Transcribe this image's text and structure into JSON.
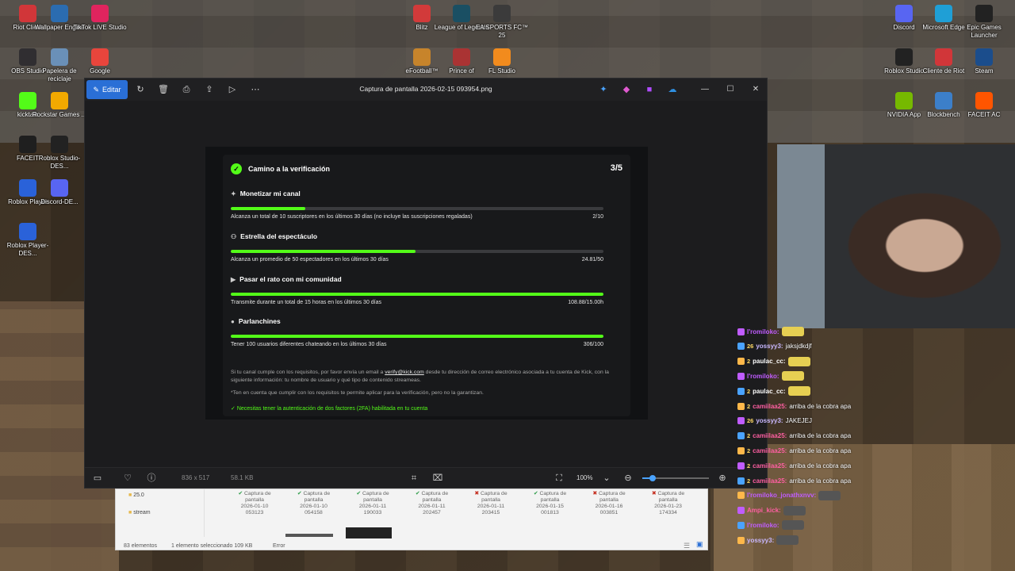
{
  "desktop": {
    "left_icons": [
      {
        "label": "Riot Client",
        "icon": "riot-icon",
        "color": "#d13639"
      },
      {
        "label": "Wallpaper Engine",
        "icon": "wallpaper-engine-icon",
        "color": "#2b6cb0"
      },
      {
        "label": "TikTok LIVE Studio",
        "icon": "tiktok-icon",
        "color": "#e0245e"
      },
      {
        "label": "OBS Studio",
        "icon": "obs-icon",
        "color": "#302e31"
      },
      {
        "label": "Papelera de reciclaje",
        "icon": "recycle-bin-icon",
        "color": "#6a90b8"
      },
      {
        "label": "Google",
        "icon": "chrome-icon",
        "color": "#e8453c"
      },
      {
        "label": "kicktalk",
        "icon": "kicktalk-icon",
        "color": "#53fc18"
      },
      {
        "label": "Rockstar Games ...",
        "icon": "rockstar-icon",
        "color": "#f2a900"
      },
      {
        "label": "FACEIT",
        "icon": "faceit-icon",
        "color": "#1f1f1f"
      },
      {
        "label": "Roblox Studio-DES...",
        "icon": "roblox-studio-icon",
        "color": "#222"
      },
      {
        "label": "Roblox Player",
        "icon": "roblox-player-icon",
        "color": "#2a62d9"
      },
      {
        "label": "Discord-DE...",
        "icon": "discord-icon",
        "color": "#5865f2"
      },
      {
        "label": "Roblox Player-DES...",
        "icon": "roblox-player-icon",
        "color": "#2a62d9"
      }
    ],
    "center_icons": [
      {
        "label": "Blitz",
        "icon": "blitz-icon",
        "color": "#d23a3a"
      },
      {
        "label": "League of Legends",
        "icon": "league-icon",
        "color": "#1a4f63"
      },
      {
        "label": "EA SPORTS FC™ 25",
        "icon": "ea-fc-icon",
        "color": "#3b3b3b"
      },
      {
        "label": "eFootball™",
        "icon": "efootball-icon",
        "color": "#c7842b"
      },
      {
        "label": "Prince of",
        "icon": "prince-icon",
        "color": "#a33"
      },
      {
        "label": "FL Studio",
        "icon": "fl-studio-icon",
        "color": "#f28b1d"
      }
    ],
    "right_icons": [
      {
        "label": "Discord",
        "icon": "discord-icon",
        "color": "#5865f2"
      },
      {
        "label": "Microsoft Edge",
        "icon": "edge-icon",
        "color": "#1f9fd6"
      },
      {
        "label": "Epic Games Launcher",
        "icon": "epic-icon",
        "color": "#222"
      },
      {
        "label": "Roblox Studio",
        "icon": "roblox-studio-icon",
        "color": "#222"
      },
      {
        "label": "Cliente de Riot",
        "icon": "riot-icon",
        "color": "#d13639"
      },
      {
        "label": "Steam",
        "icon": "steam-icon",
        "color": "#1b4d8c"
      },
      {
        "label": "NVIDIA App",
        "icon": "nvidia-icon",
        "color": "#76b900"
      },
      {
        "label": "Blockbench",
        "icon": "blockbench-icon",
        "color": "#3c7fc9"
      },
      {
        "label": "FACEIT AC",
        "icon": "faceit-icon",
        "color": "#ff5500"
      }
    ]
  },
  "viewer": {
    "edit_label": "Editar",
    "title": "Captura de pantalla 2026-02-15 093954.png",
    "dimensions": "836 x 517",
    "filesize": "58.1 KB",
    "zoom": "100%"
  },
  "kick": {
    "header_title": "Camino a la verificación",
    "step_count": "3/5",
    "sections": [
      {
        "title": "Monetizar mi canal",
        "desc": "Alcanza un total de 10 suscriptores en los últimos 30 días (no incluye las suscripciones regaladas)",
        "value": "2/10",
        "progress": 0.2
      },
      {
        "title": "Estrella del espectáculo",
        "desc": "Alcanza un promedio de 50 espectadores en los últimos 30 días",
        "value": "24.81/50",
        "progress": 0.4962
      },
      {
        "title": "Pasar el rato con mi comunidad",
        "desc": "Transmite durante un total de 15 horas en los últimos 30 días",
        "value": "108.88/15.00h",
        "progress": 1.0
      },
      {
        "title": "Parlanchines",
        "desc": "Tener 100 usuarios diferentes chateando en los últimos 30 días",
        "value": "306/100",
        "progress": 1.0
      }
    ],
    "note_pre": "Si tu canal cumple con los requisitos, por favor envía un email a",
    "note_email": "verify@kick.com",
    "note_post": "desde tu dirección de correo electrónico asociada a tu cuenta de Kick, con la siguiente información: tu nombre de usuario y qué tipo de contenido streameas.",
    "note_2": "*Ten en cuenta que cumplir con los requisitos te permite aplicar para la verificación, pero no la garantizan.",
    "twofa": "Necesitas tener la autenticación de dos factores (2FA) habilitada en tu cuenta"
  },
  "explorer": {
    "side_items": [
      "25.0",
      "stream"
    ],
    "files": [
      {
        "l1": "Captura de",
        "l2": "pantalla",
        "l3": "2026-01-10",
        "l4": "053123",
        "status": "ok"
      },
      {
        "l1": "Captura de",
        "l2": "pantalla",
        "l3": "2026-01-10",
        "l4": "054158",
        "status": "ok"
      },
      {
        "l1": "Captura de",
        "l2": "pantalla",
        "l3": "2026-01-11",
        "l4": "190033",
        "status": "ok"
      },
      {
        "l1": "Captura de",
        "l2": "pantalla",
        "l3": "2026-01-11",
        "l4": "202457",
        "status": "ok"
      },
      {
        "l1": "Captura de",
        "l2": "pantalla",
        "l3": "2026-01-11",
        "l4": "203415",
        "status": "err"
      },
      {
        "l1": "Captura de",
        "l2": "pantalla",
        "l3": "2026-01-15",
        "l4": "001813",
        "status": "ok"
      },
      {
        "l1": "Captura de",
        "l2": "pantalla",
        "l3": "2026-01-16",
        "l4": "003851",
        "status": "err"
      },
      {
        "l1": "Captura de",
        "l2": "pantalla",
        "l3": "2026-01-23",
        "l4": "174334",
        "status": "err"
      }
    ],
    "status_count": "83 elementos",
    "status_selected": "1 elemento seleccionado 109 KB",
    "status_error": "Error"
  },
  "chat": [
    {
      "num": "",
      "user": "l'romiloko:",
      "color": "#c05cff",
      "text": "",
      "emote": true
    },
    {
      "num": "26",
      "user": "yossyy3:",
      "color": "#c9b8ff",
      "text": "jaksjdkdjf",
      "emote": false
    },
    {
      "num": "2",
      "user": "paulac_cc:",
      "color": "#ffffff",
      "text": "",
      "emote": true
    },
    {
      "num": "",
      "user": "l'romiloko:",
      "color": "#c05cff",
      "text": "",
      "emote": true
    },
    {
      "num": "2",
      "user": "paulac_cc:",
      "color": "#ffffff",
      "text": "",
      "emote": true
    },
    {
      "num": "2",
      "user": "camiilaa25:",
      "color": "#ff5fa2",
      "text": "arriba de la cobra apa",
      "emote": false
    },
    {
      "num": "26",
      "user": "yossyy3:",
      "color": "#c9b8ff",
      "text": "JAKEJEJ",
      "emote": false
    },
    {
      "num": "2",
      "user": "camiilaa25:",
      "color": "#ff5fa2",
      "text": "arriba de la cobra apa",
      "emote": false
    },
    {
      "num": "2",
      "user": "camiilaa25:",
      "color": "#ff5fa2",
      "text": "arriba de la cobra apa",
      "emote": false
    },
    {
      "num": "2",
      "user": "camiilaa25:",
      "color": "#ff5fa2",
      "text": "arriba de la cobra apa",
      "emote": false
    },
    {
      "num": "2",
      "user": "camiilaa25:",
      "color": "#ff5fa2",
      "text": "arriba de la cobra apa",
      "emote": false
    },
    {
      "num": "",
      "user": "l'romiloko_jonathxnvv:",
      "color": "#c05cff",
      "text": "",
      "emote": true
    },
    {
      "num": "",
      "user": "Ampi_kick:",
      "color": "#ff5fa2",
      "text": "",
      "emote": true
    },
    {
      "num": "",
      "user": "l'romiloko:",
      "color": "#c05cff",
      "text": "",
      "emote": true
    },
    {
      "num": "",
      "user": "yossyy3:",
      "color": "#c9b8ff",
      "text": "",
      "emote": true
    }
  ],
  "colors": {
    "kick_green": "#53fc18",
    "accent_blue": "#2a6fd6"
  }
}
